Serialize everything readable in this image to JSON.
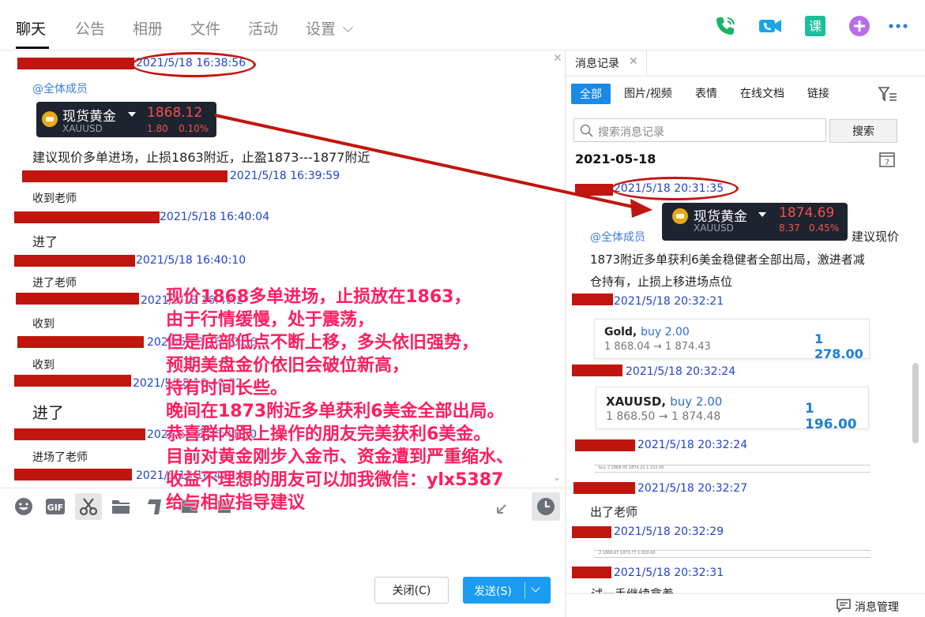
{
  "tabs": [
    {
      "label": "聊天",
      "active": true
    },
    {
      "label": "公告"
    },
    {
      "label": "相册"
    },
    {
      "label": "文件"
    },
    {
      "label": "活动"
    },
    {
      "label": "设置"
    }
  ],
  "toolbar_icons": [
    "phone-icon",
    "video-icon",
    "course-icon",
    "add-icon",
    "more-icon"
  ],
  "colors": {
    "redact": "#c0160f",
    "timestamp": "#2344c8",
    "overlay": "#ff1e5f",
    "accent": "#1a9cf0",
    "up": "#f0514a"
  },
  "chat": {
    "mention": "@全体成员",
    "messages": [
      {
        "time": "2021/5/18 16:38:56"
      },
      {
        "time": "2021/5/18 16:39:59",
        "text": "收到老师"
      },
      {
        "time": "2021/5/18 16:40:04",
        "text": "进了"
      },
      {
        "time": "2021/5/18 16:40:10",
        "text": "进了老师"
      },
      {
        "time": "2021/5/18 16:40:2",
        "text": "收到"
      },
      {
        "time": "2021/5/18 16:40:36",
        "text": "收到"
      },
      {
        "time": "2021/5/18 16:40:52",
        "text": "进了"
      },
      {
        "time": "2021/5/18 16:41:00",
        "text": "进场了老师"
      },
      {
        "time": "2021/5/18 16:41:"
      }
    ],
    "first_text": "建议现价多单进场，止损1863附近，止盈1873---1877附近",
    "quote": {
      "name": "现货黄金",
      "symbol": "XAUUSD",
      "price": "1868.12",
      "change": "1.80",
      "pct": "0.10%"
    }
  },
  "buttons": {
    "close": "关闭(C)",
    "send": "发送(S)"
  },
  "history": {
    "title": "消息记录",
    "filters": [
      "全部",
      "图片/视频",
      "表情",
      "在线文档",
      "链接"
    ],
    "search_placeholder": "搜索消息记录",
    "search_button": "搜索",
    "date": "2021-05-18",
    "first_time": "2021/5/18 20:31:35",
    "quote": {
      "name": "现货黄金",
      "symbol": "XAUUSD",
      "price": "1874.69",
      "change": "8.37",
      "pct": "0.45%"
    },
    "mention": "@全体成员",
    "msg_tail": "建议现价",
    "msg_line2": "1873附近多单获利6美金稳健者全部出局，激进者减",
    "msg_line3": "仓持有，止损上移进场点位",
    "entries": [
      {
        "time": "2021/5/18 20:32:21"
      },
      {
        "time": "2021/5/18 20:32:24"
      },
      {
        "time": "2021/5/18 20:32:24"
      },
      {
        "time": "2021/5/18 20:32:27",
        "text": "出了老师"
      },
      {
        "time": "2021/5/18 20:32:29"
      },
      {
        "time": "2021/5/18 20:32:31",
        "text": "试一手继续拿着"
      }
    ],
    "trade1": {
      "title": "Gold,",
      "action": "buy 2.00",
      "range": "1 868.04 → 1 874.43",
      "amount": "1 278.00"
    },
    "trade2": {
      "title": "XAUUSD,",
      "action": "buy 2.00",
      "range": "1 868.50 → 1 874.48",
      "amount": "1 196.00"
    },
    "stripe1": "buy    2    1868.05    1874.21    1 232.00",
    "stripe2": "2    1868.67    1873.77    1 020.00",
    "management": "消息管理"
  },
  "overlay_lines": [
    "现价1868多单进场，止损放在1863，",
    "由于行情缓慢，处于震荡，",
    "但是底部低点不断上移，多头依旧强势，",
    "预期美盘金价依旧会破位新高，",
    "持有时间长些。",
    "晚间在1873附近多单获利6美金全部出局。",
    "恭喜群内跟上操作的朋友完美获利6美金。",
    "目前对黄金刚步入金市、资金遭到严重缩水、",
    "收益不理想的朋友可以加我微信：ylx5387",
    "给与相应指导建议"
  ]
}
